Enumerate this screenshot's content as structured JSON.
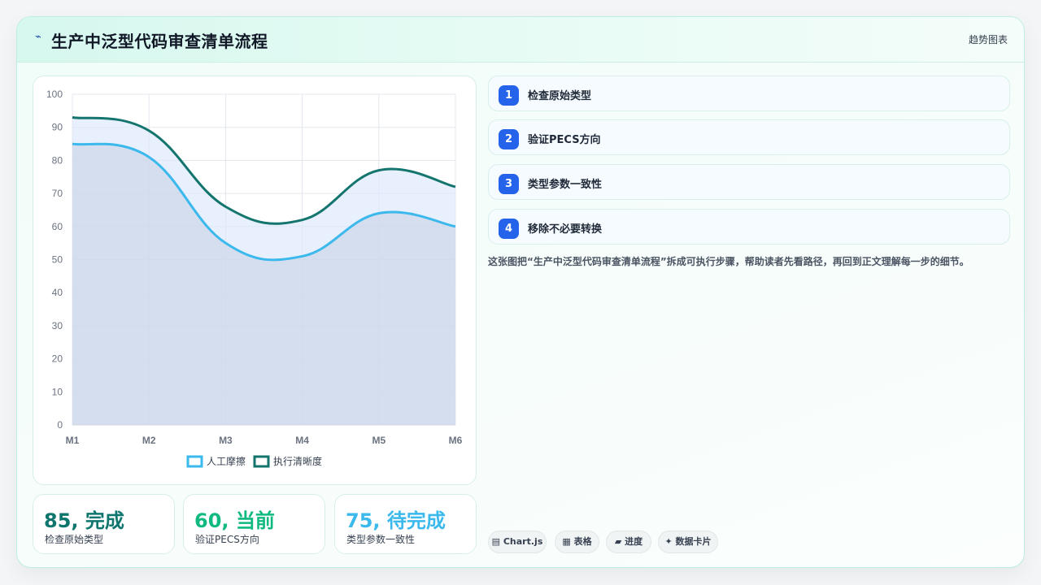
{
  "header": {
    "logo_glyph": "⌁",
    "title": "生产中泛型代码审查清单流程",
    "tag": "趋势图表"
  },
  "chart_data": {
    "type": "line",
    "categories": [
      "M1",
      "M2",
      "M3",
      "M4",
      "M5",
      "M6"
    ],
    "ylim": [
      0,
      100
    ],
    "yticks": [
      0,
      10,
      20,
      30,
      40,
      50,
      60,
      70,
      80,
      90,
      100
    ],
    "grid": true,
    "legend_position": "bottom",
    "series": [
      {
        "name": "人工摩擦",
        "values": [
          85,
          81,
          55,
          51,
          64,
          60
        ],
        "color": "#3bb8ec",
        "fill": "rgba(196,208,228,0.55)"
      },
      {
        "name": "执行清晰度",
        "values": [
          93,
          89,
          66,
          62,
          77,
          72
        ],
        "color": "#13756e",
        "fill": "rgba(222,232,252,0.7)"
      }
    ]
  },
  "stats": [
    {
      "value": "85, 完成",
      "label": "检查原始类型",
      "color": "#0f766e"
    },
    {
      "value": "60, 当前",
      "label": "验证PECS方向",
      "color": "#10b981"
    },
    {
      "value": "75, 待完成",
      "label": "类型参数一致性",
      "color": "#3bb8ec"
    }
  ],
  "steps": [
    {
      "num": "1",
      "label": "检查原始类型"
    },
    {
      "num": "2",
      "label": "验证PECS方向"
    },
    {
      "num": "3",
      "label": "类型参数一致性"
    },
    {
      "num": "4",
      "label": "移除不必要转换"
    }
  ],
  "description": "这张图把“生产中泛型代码审查清单流程”拆成可执行步骤，帮助读者先看路径，再回到正文理解每一步的细节。",
  "pills": [
    {
      "icon": "▤",
      "label": "Chart.js"
    },
    {
      "icon": "▦",
      "label": "表格"
    },
    {
      "icon": "▰",
      "label": "进度"
    },
    {
      "icon": "✦",
      "label": "数据卡片"
    }
  ]
}
